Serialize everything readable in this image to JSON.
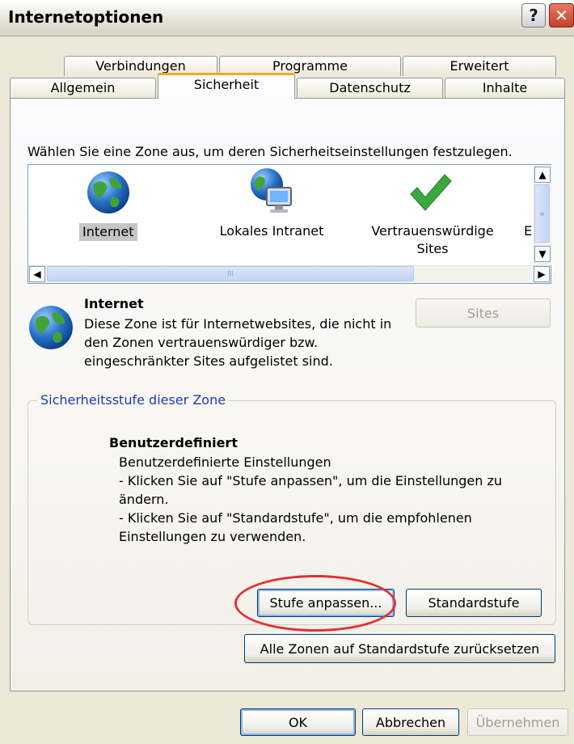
{
  "window": {
    "title": "Internetoptionen",
    "help_label": "?",
    "close_label": "✕"
  },
  "tabs": {
    "row1": [
      "Verbindungen",
      "Programme",
      "Erweitert"
    ],
    "row2": [
      "Allgemein",
      "Sicherheit",
      "Datenschutz",
      "Inhalte"
    ],
    "selected": "Sicherheit"
  },
  "zone_prompt": "Wählen Sie eine Zone aus, um deren Sicherheitseinstellungen festzulegen.",
  "zones": [
    {
      "label": "Internet",
      "icon": "globe-icon",
      "selected": true
    },
    {
      "label": "Lokales Intranet",
      "icon": "network-computer-icon"
    },
    {
      "label_line1": "Vertrauenswürdige",
      "label_line2": "Sites",
      "icon": "checkmark-icon"
    },
    {
      "label": "E",
      "icon": "restricted-sites-icon"
    }
  ],
  "scrollbar": {
    "up": "▲",
    "down": "▼",
    "left": "◀",
    "right": "▶",
    "grip": "III"
  },
  "zone_info": {
    "title": "Internet",
    "line1": "Diese Zone ist für Internetwebsites, die nicht in",
    "line2": "den Zonen vertrauenswürdiger bzw.",
    "line3": "eingeschränkter Sites aufgelistet sind.",
    "sites_button": "Sites"
  },
  "security_level": {
    "group_label": "Sicherheitsstufe dieser Zone",
    "level_title": "Benutzerdefiniert",
    "line1": "Benutzerdefinierte Einstellungen",
    "line2": "- Klicken Sie auf \"Stufe anpassen\", um die Einstellungen zu",
    "line3": "ändern.",
    "line4": "- Klicken Sie auf \"Standardstufe\", um die empfohlenen",
    "line5": "Einstellungen zu verwenden.",
    "custom_level_button": "Stufe anpassen...",
    "default_level_button": "Standardstufe"
  },
  "reset_all_button": "Alle Zonen auf Standardstufe zurücksetzen",
  "footer": {
    "ok": "OK",
    "cancel": "Abbrechen",
    "apply": "Übernehmen"
  },
  "colors": {
    "dialog_bg": "#ece9d8",
    "selected_tab_accent": "#f5a623",
    "highlight_ellipse": "#e03236",
    "close_button": "#d0563d",
    "group_label": "#1e3cb4"
  }
}
